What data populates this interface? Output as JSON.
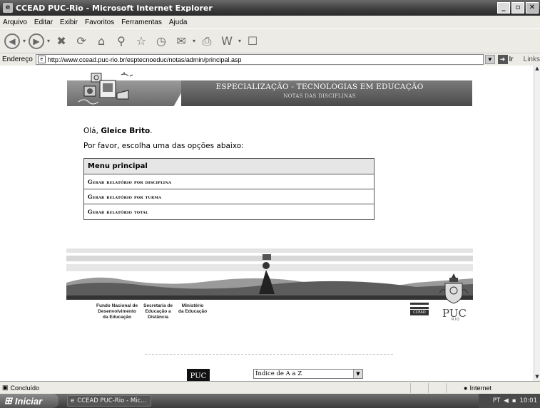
{
  "window": {
    "title": "CCEAD PUC-Rio - Microsoft Internet Explorer",
    "icon": "ie-icon"
  },
  "menubar": {
    "items": [
      "Arquivo",
      "Editar",
      "Exibir",
      "Favoritos",
      "Ferramentas",
      "Ajuda"
    ]
  },
  "toolbar": {
    "buttons": [
      "back-icon",
      "forward-icon",
      "stop-icon",
      "refresh-icon",
      "home-icon",
      "search-icon",
      "favorites-icon",
      "history-icon",
      "mail-icon",
      "print-icon",
      "word-icon",
      "discuss-icon"
    ]
  },
  "address": {
    "label": "Endereço",
    "url": "http://www.ccead.puc-rio.br/esptecnoeduc/notas/admin/principal.asp",
    "go_label": "Ir",
    "links_label": "Links"
  },
  "banner": {
    "title": "ESPECIALIZAÇÃO - TECNOLOGIAS EM EDUCAÇÃO",
    "subtitle": "NOTAS DAS DISCIPLINAS"
  },
  "main": {
    "greeting_prefix": "Olá,",
    "user_name": "Gleice Brito",
    "greeting_suffix": ".",
    "instruction": "Por favor, escolha uma das opções abaixo:",
    "menu_title": "Menu principal",
    "menu_items": [
      "Gerar relatório por disciplina",
      "Gerar relatório por turma",
      "Gerar relatório total"
    ]
  },
  "partners": [
    {
      "line1": "Fundo Nacional de",
      "line2": "Desenvolvimento",
      "line3": "da Educação"
    },
    {
      "line1": "Secretaria de",
      "line2": "Educação a",
      "line3": "Distância"
    },
    {
      "line1": "Ministério",
      "line2": "da Educação",
      "line3": ""
    }
  ],
  "logos": {
    "ccead": "CCEAD",
    "puc": "PUC",
    "puc_sub": "RIO",
    "puc_bottom": "PUC"
  },
  "index_select": {
    "selected": "Índice de A a Z"
  },
  "status": {
    "text": "Concluído",
    "zone": "Internet"
  },
  "taskbar": {
    "start": "Iniciar",
    "task": "CCEAD PUC-Rio - Mic...",
    "lang": "PT",
    "clock": "10:01"
  }
}
